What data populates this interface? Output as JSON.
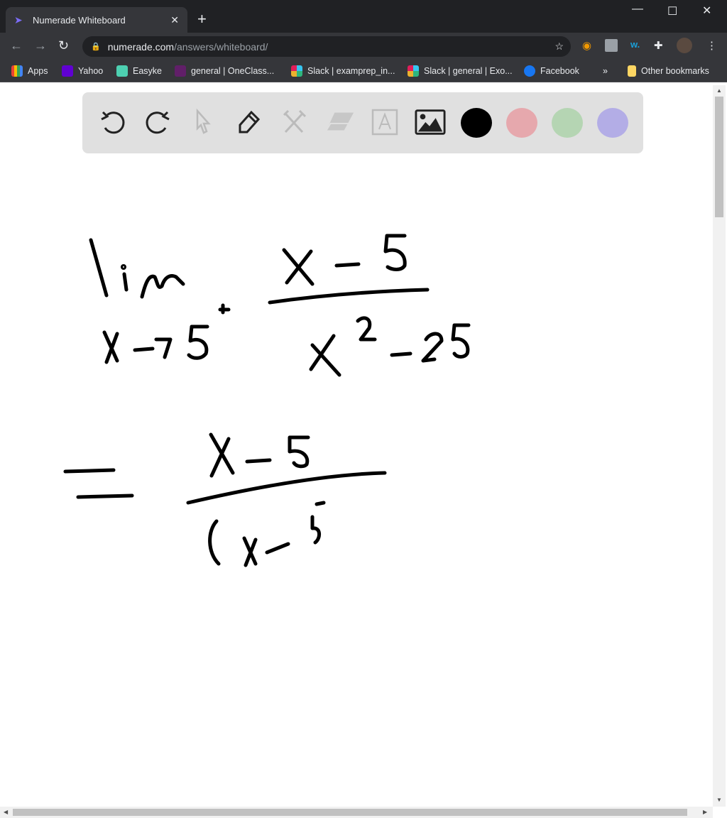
{
  "browser": {
    "tab": {
      "title": "Numerade Whiteboard",
      "favicon": "numerade-logo-icon"
    },
    "url": {
      "host": "numerade.com",
      "path": "/answers/whiteboard/"
    },
    "bookmarks": [
      {
        "label": "Apps",
        "icon": "apps-grid-icon",
        "color": "#ea4335"
      },
      {
        "label": "Yahoo",
        "icon": "yahoo-icon",
        "color": "#6001d2"
      },
      {
        "label": "Easyke",
        "icon": "easyke-icon",
        "color": "#4dd0b1"
      },
      {
        "label": "general | OneClass...",
        "icon": "slack-icon",
        "color": "#611f69"
      },
      {
        "label": "Slack | examprep_in...",
        "icon": "slack-icon",
        "color": "#36c5f0"
      },
      {
        "label": "Slack | general | Exo...",
        "icon": "slack-icon",
        "color": "#e01e5a"
      },
      {
        "label": "Facebook",
        "icon": "facebook-icon",
        "color": "#1877f2"
      }
    ],
    "more_bookmarks": "»",
    "other_bookmarks": "Other bookmarks"
  },
  "whiteboard": {
    "tools": [
      "undo-icon",
      "redo-icon",
      "select-icon",
      "pen-icon",
      "tools-icon",
      "eraser-icon",
      "text-icon",
      "image-icon"
    ],
    "colors": [
      "#000000",
      "#e6a8ad",
      "#b5d5b3",
      "#b3ade6"
    ]
  }
}
